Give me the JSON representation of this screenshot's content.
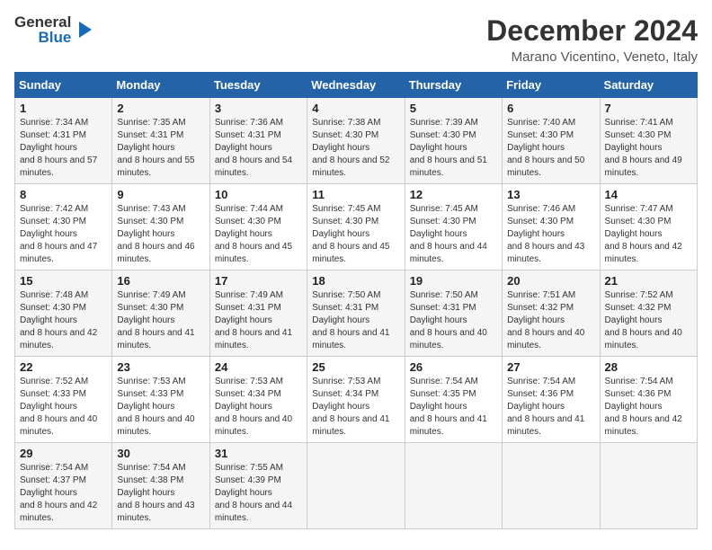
{
  "header": {
    "logo_general": "General",
    "logo_blue": "Blue",
    "title": "December 2024",
    "subtitle": "Marano Vicentino, Veneto, Italy"
  },
  "columns": [
    "Sunday",
    "Monday",
    "Tuesday",
    "Wednesday",
    "Thursday",
    "Friday",
    "Saturday"
  ],
  "weeks": [
    [
      {
        "day": "1",
        "sunrise": "7:34 AM",
        "sunset": "4:31 PM",
        "daylight": "8 hours and 57 minutes."
      },
      {
        "day": "2",
        "sunrise": "7:35 AM",
        "sunset": "4:31 PM",
        "daylight": "8 hours and 55 minutes."
      },
      {
        "day": "3",
        "sunrise": "7:36 AM",
        "sunset": "4:31 PM",
        "daylight": "8 hours and 54 minutes."
      },
      {
        "day": "4",
        "sunrise": "7:38 AM",
        "sunset": "4:30 PM",
        "daylight": "8 hours and 52 minutes."
      },
      {
        "day": "5",
        "sunrise": "7:39 AM",
        "sunset": "4:30 PM",
        "daylight": "8 hours and 51 minutes."
      },
      {
        "day": "6",
        "sunrise": "7:40 AM",
        "sunset": "4:30 PM",
        "daylight": "8 hours and 50 minutes."
      },
      {
        "day": "7",
        "sunrise": "7:41 AM",
        "sunset": "4:30 PM",
        "daylight": "8 hours and 49 minutes."
      }
    ],
    [
      {
        "day": "8",
        "sunrise": "7:42 AM",
        "sunset": "4:30 PM",
        "daylight": "8 hours and 47 minutes."
      },
      {
        "day": "9",
        "sunrise": "7:43 AM",
        "sunset": "4:30 PM",
        "daylight": "8 hours and 46 minutes."
      },
      {
        "day": "10",
        "sunrise": "7:44 AM",
        "sunset": "4:30 PM",
        "daylight": "8 hours and 45 minutes."
      },
      {
        "day": "11",
        "sunrise": "7:45 AM",
        "sunset": "4:30 PM",
        "daylight": "8 hours and 45 minutes."
      },
      {
        "day": "12",
        "sunrise": "7:45 AM",
        "sunset": "4:30 PM",
        "daylight": "8 hours and 44 minutes."
      },
      {
        "day": "13",
        "sunrise": "7:46 AM",
        "sunset": "4:30 PM",
        "daylight": "8 hours and 43 minutes."
      },
      {
        "day": "14",
        "sunrise": "7:47 AM",
        "sunset": "4:30 PM",
        "daylight": "8 hours and 42 minutes."
      }
    ],
    [
      {
        "day": "15",
        "sunrise": "7:48 AM",
        "sunset": "4:30 PM",
        "daylight": "8 hours and 42 minutes."
      },
      {
        "day": "16",
        "sunrise": "7:49 AM",
        "sunset": "4:30 PM",
        "daylight": "8 hours and 41 minutes."
      },
      {
        "day": "17",
        "sunrise": "7:49 AM",
        "sunset": "4:31 PM",
        "daylight": "8 hours and 41 minutes."
      },
      {
        "day": "18",
        "sunrise": "7:50 AM",
        "sunset": "4:31 PM",
        "daylight": "8 hours and 41 minutes."
      },
      {
        "day": "19",
        "sunrise": "7:50 AM",
        "sunset": "4:31 PM",
        "daylight": "8 hours and 40 minutes."
      },
      {
        "day": "20",
        "sunrise": "7:51 AM",
        "sunset": "4:32 PM",
        "daylight": "8 hours and 40 minutes."
      },
      {
        "day": "21",
        "sunrise": "7:52 AM",
        "sunset": "4:32 PM",
        "daylight": "8 hours and 40 minutes."
      }
    ],
    [
      {
        "day": "22",
        "sunrise": "7:52 AM",
        "sunset": "4:33 PM",
        "daylight": "8 hours and 40 minutes."
      },
      {
        "day": "23",
        "sunrise": "7:53 AM",
        "sunset": "4:33 PM",
        "daylight": "8 hours and 40 minutes."
      },
      {
        "day": "24",
        "sunrise": "7:53 AM",
        "sunset": "4:34 PM",
        "daylight": "8 hours and 40 minutes."
      },
      {
        "day": "25",
        "sunrise": "7:53 AM",
        "sunset": "4:34 PM",
        "daylight": "8 hours and 41 minutes."
      },
      {
        "day": "26",
        "sunrise": "7:54 AM",
        "sunset": "4:35 PM",
        "daylight": "8 hours and 41 minutes."
      },
      {
        "day": "27",
        "sunrise": "7:54 AM",
        "sunset": "4:36 PM",
        "daylight": "8 hours and 41 minutes."
      },
      {
        "day": "28",
        "sunrise": "7:54 AM",
        "sunset": "4:36 PM",
        "daylight": "8 hours and 42 minutes."
      }
    ],
    [
      {
        "day": "29",
        "sunrise": "7:54 AM",
        "sunset": "4:37 PM",
        "daylight": "8 hours and 42 minutes."
      },
      {
        "day": "30",
        "sunrise": "7:54 AM",
        "sunset": "4:38 PM",
        "daylight": "8 hours and 43 minutes."
      },
      {
        "day": "31",
        "sunrise": "7:55 AM",
        "sunset": "4:39 PM",
        "daylight": "8 hours and 44 minutes."
      },
      null,
      null,
      null,
      null
    ]
  ]
}
